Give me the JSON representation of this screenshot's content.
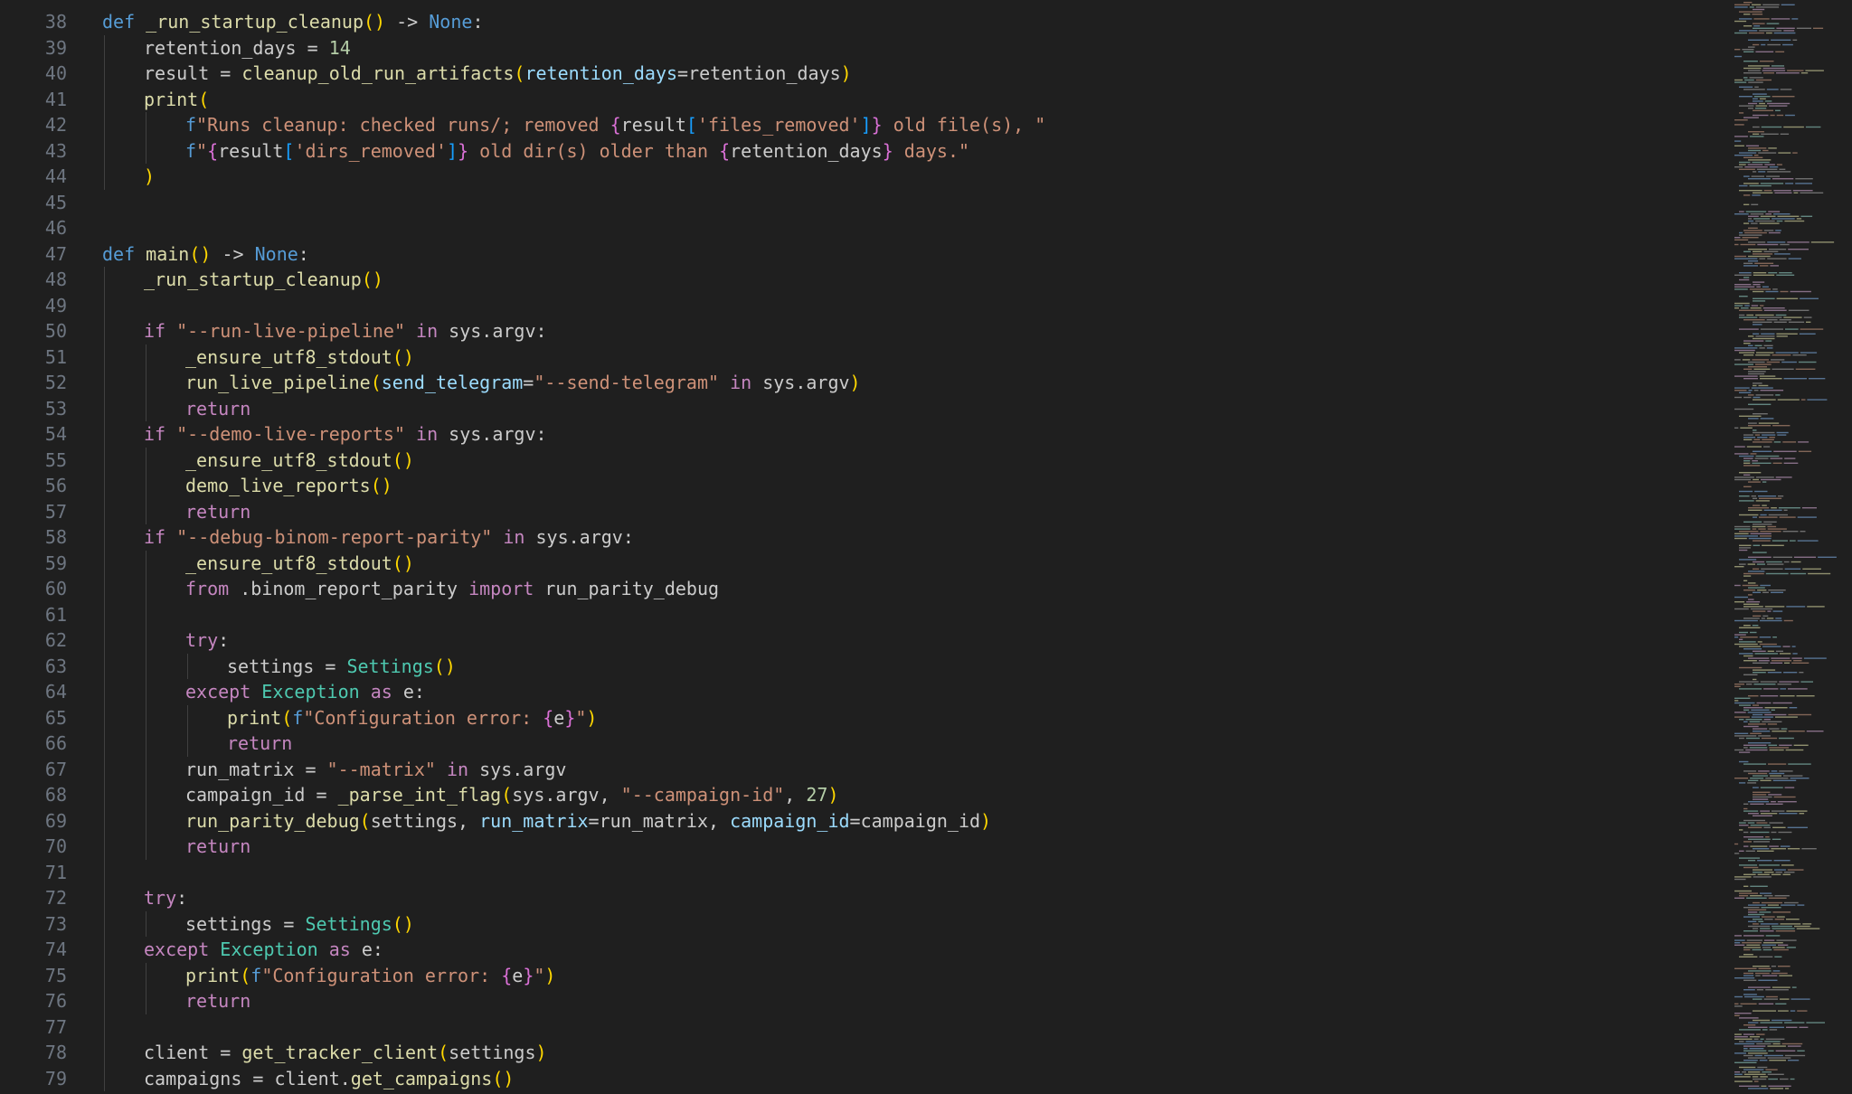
{
  "editor": {
    "colors": {
      "background": "#1f1f1f",
      "line_number": "#6e7681",
      "plain": "#cccccc",
      "keyword": "#569cd6",
      "control": "#c586c0",
      "function": "#dcdcaa",
      "string": "#ce9178",
      "number": "#b5cea8",
      "parameter": "#9cdcfe",
      "class": "#4ec9b0",
      "bracket_1": "#ffd700",
      "bracket_2": "#da70d6",
      "bracket_3": "#179fff"
    },
    "lines": [
      {
        "n": "38",
        "indent": 0,
        "tokens": [
          [
            "kw",
            "def "
          ],
          [
            "fn",
            "_run_startup_cleanup"
          ],
          [
            "br1",
            "()"
          ],
          [
            "plain",
            " -> "
          ],
          [
            "kw",
            "None"
          ],
          [
            "plain",
            ":"
          ]
        ]
      },
      {
        "n": "39",
        "indent": 1,
        "tokens": [
          [
            "plain",
            "retention_days = "
          ],
          [
            "num",
            "14"
          ]
        ]
      },
      {
        "n": "40",
        "indent": 1,
        "tokens": [
          [
            "plain",
            "result = "
          ],
          [
            "fn",
            "cleanup_old_run_artifacts"
          ],
          [
            "br1",
            "("
          ],
          [
            "param",
            "retention_days"
          ],
          [
            "plain",
            "=retention_days"
          ],
          [
            "br1",
            ")"
          ]
        ]
      },
      {
        "n": "41",
        "indent": 1,
        "tokens": [
          [
            "fn",
            "print"
          ],
          [
            "br1",
            "("
          ]
        ]
      },
      {
        "n": "42",
        "indent": 2,
        "tokens": [
          [
            "kw",
            "f"
          ],
          [
            "str",
            "\"Runs cleanup: checked runs/; removed "
          ],
          [
            "br2",
            "{"
          ],
          [
            "plain",
            "result"
          ],
          [
            "br3",
            "["
          ],
          [
            "str",
            "'files_removed'"
          ],
          [
            "br3",
            "]"
          ],
          [
            "br2",
            "}"
          ],
          [
            "str",
            " old file(s), \""
          ]
        ]
      },
      {
        "n": "43",
        "indent": 2,
        "tokens": [
          [
            "kw",
            "f"
          ],
          [
            "str",
            "\""
          ],
          [
            "br2",
            "{"
          ],
          [
            "plain",
            "result"
          ],
          [
            "br3",
            "["
          ],
          [
            "str",
            "'dirs_removed'"
          ],
          [
            "br3",
            "]"
          ],
          [
            "br2",
            "}"
          ],
          [
            "str",
            " old dir(s) older than "
          ],
          [
            "br2",
            "{"
          ],
          [
            "plain",
            "retention_days"
          ],
          [
            "br2",
            "}"
          ],
          [
            "str",
            " days.\""
          ]
        ]
      },
      {
        "n": "44",
        "indent": 1,
        "tokens": [
          [
            "br1",
            ")"
          ]
        ]
      },
      {
        "n": "45",
        "indent": 0,
        "tokens": []
      },
      {
        "n": "46",
        "indent": 0,
        "tokens": []
      },
      {
        "n": "47",
        "indent": 0,
        "tokens": [
          [
            "kw",
            "def "
          ],
          [
            "fn",
            "main"
          ],
          [
            "br1",
            "()"
          ],
          [
            "plain",
            " -> "
          ],
          [
            "kw",
            "None"
          ],
          [
            "plain",
            ":"
          ]
        ]
      },
      {
        "n": "48",
        "indent": 1,
        "tokens": [
          [
            "fn",
            "_run_startup_cleanup"
          ],
          [
            "br1",
            "()"
          ]
        ]
      },
      {
        "n": "49",
        "indent": 1,
        "tokens": []
      },
      {
        "n": "50",
        "indent": 1,
        "tokens": [
          [
            "ctl",
            "if "
          ],
          [
            "str",
            "\"--run-live-pipeline\""
          ],
          [
            "ctl",
            " in"
          ],
          [
            "plain",
            " sys.argv:"
          ]
        ]
      },
      {
        "n": "51",
        "indent": 2,
        "tokens": [
          [
            "fn",
            "_ensure_utf8_stdout"
          ],
          [
            "br1",
            "()"
          ]
        ]
      },
      {
        "n": "52",
        "indent": 2,
        "tokens": [
          [
            "fn",
            "run_live_pipeline"
          ],
          [
            "br1",
            "("
          ],
          [
            "param",
            "send_telegram"
          ],
          [
            "plain",
            "="
          ],
          [
            "str",
            "\"--send-telegram\""
          ],
          [
            "ctl",
            " in"
          ],
          [
            "plain",
            " sys.argv"
          ],
          [
            "br1",
            ")"
          ]
        ]
      },
      {
        "n": "53",
        "indent": 2,
        "tokens": [
          [
            "ctl",
            "return"
          ]
        ]
      },
      {
        "n": "54",
        "indent": 1,
        "tokens": [
          [
            "ctl",
            "if "
          ],
          [
            "str",
            "\"--demo-live-reports\""
          ],
          [
            "ctl",
            " in"
          ],
          [
            "plain",
            " sys.argv:"
          ]
        ]
      },
      {
        "n": "55",
        "indent": 2,
        "tokens": [
          [
            "fn",
            "_ensure_utf8_stdout"
          ],
          [
            "br1",
            "()"
          ]
        ]
      },
      {
        "n": "56",
        "indent": 2,
        "tokens": [
          [
            "fn",
            "demo_live_reports"
          ],
          [
            "br1",
            "()"
          ]
        ]
      },
      {
        "n": "57",
        "indent": 2,
        "tokens": [
          [
            "ctl",
            "return"
          ]
        ]
      },
      {
        "n": "58",
        "indent": 1,
        "tokens": [
          [
            "ctl",
            "if "
          ],
          [
            "str",
            "\"--debug-binom-report-parity\""
          ],
          [
            "ctl",
            " in"
          ],
          [
            "plain",
            " sys.argv:"
          ]
        ]
      },
      {
        "n": "59",
        "indent": 2,
        "tokens": [
          [
            "fn",
            "_ensure_utf8_stdout"
          ],
          [
            "br1",
            "()"
          ]
        ]
      },
      {
        "n": "60",
        "indent": 2,
        "tokens": [
          [
            "ctl",
            "from"
          ],
          [
            "plain",
            " .binom_report_parity "
          ],
          [
            "ctl",
            "import"
          ],
          [
            "plain",
            " run_parity_debug"
          ]
        ]
      },
      {
        "n": "61",
        "indent": 2,
        "tokens": []
      },
      {
        "n": "62",
        "indent": 2,
        "tokens": [
          [
            "ctl",
            "try"
          ],
          [
            "plain",
            ":"
          ]
        ]
      },
      {
        "n": "63",
        "indent": 3,
        "tokens": [
          [
            "plain",
            "settings = "
          ],
          [
            "cls",
            "Settings"
          ],
          [
            "br1",
            "()"
          ]
        ]
      },
      {
        "n": "64",
        "indent": 2,
        "tokens": [
          [
            "ctl",
            "except "
          ],
          [
            "cls",
            "Exception"
          ],
          [
            "ctl",
            " as"
          ],
          [
            "plain",
            " e:"
          ]
        ]
      },
      {
        "n": "65",
        "indent": 3,
        "tokens": [
          [
            "fn",
            "print"
          ],
          [
            "br1",
            "("
          ],
          [
            "kw",
            "f"
          ],
          [
            "str",
            "\"Configuration error: "
          ],
          [
            "br2",
            "{"
          ],
          [
            "plain",
            "e"
          ],
          [
            "br2",
            "}"
          ],
          [
            "str",
            "\""
          ],
          [
            "br1",
            ")"
          ]
        ]
      },
      {
        "n": "66",
        "indent": 3,
        "tokens": [
          [
            "ctl",
            "return"
          ]
        ]
      },
      {
        "n": "67",
        "indent": 2,
        "tokens": [
          [
            "plain",
            "run_matrix = "
          ],
          [
            "str",
            "\"--matrix\""
          ],
          [
            "ctl",
            " in"
          ],
          [
            "plain",
            " sys.argv"
          ]
        ]
      },
      {
        "n": "68",
        "indent": 2,
        "tokens": [
          [
            "plain",
            "campaign_id = "
          ],
          [
            "fn",
            "_parse_int_flag"
          ],
          [
            "br1",
            "("
          ],
          [
            "plain",
            "sys.argv, "
          ],
          [
            "str",
            "\"--campaign-id\""
          ],
          [
            "plain",
            ", "
          ],
          [
            "num",
            "27"
          ],
          [
            "br1",
            ")"
          ]
        ]
      },
      {
        "n": "69",
        "indent": 2,
        "tokens": [
          [
            "fn",
            "run_parity_debug"
          ],
          [
            "br1",
            "("
          ],
          [
            "plain",
            "settings, "
          ],
          [
            "param",
            "run_matrix"
          ],
          [
            "plain",
            "=run_matrix, "
          ],
          [
            "param",
            "campaign_id"
          ],
          [
            "plain",
            "=campaign_id"
          ],
          [
            "br1",
            ")"
          ]
        ]
      },
      {
        "n": "70",
        "indent": 2,
        "tokens": [
          [
            "ctl",
            "return"
          ]
        ]
      },
      {
        "n": "71",
        "indent": 1,
        "tokens": []
      },
      {
        "n": "72",
        "indent": 1,
        "tokens": [
          [
            "ctl",
            "try"
          ],
          [
            "plain",
            ":"
          ]
        ]
      },
      {
        "n": "73",
        "indent": 2,
        "tokens": [
          [
            "plain",
            "settings = "
          ],
          [
            "cls",
            "Settings"
          ],
          [
            "br1",
            "()"
          ]
        ]
      },
      {
        "n": "74",
        "indent": 1,
        "tokens": [
          [
            "ctl",
            "except "
          ],
          [
            "cls",
            "Exception"
          ],
          [
            "ctl",
            " as"
          ],
          [
            "plain",
            " e:"
          ]
        ]
      },
      {
        "n": "75",
        "indent": 2,
        "tokens": [
          [
            "fn",
            "print"
          ],
          [
            "br1",
            "("
          ],
          [
            "kw",
            "f"
          ],
          [
            "str",
            "\"Configuration error: "
          ],
          [
            "br2",
            "{"
          ],
          [
            "plain",
            "e"
          ],
          [
            "br2",
            "}"
          ],
          [
            "str",
            "\""
          ],
          [
            "br1",
            ")"
          ]
        ]
      },
      {
        "n": "76",
        "indent": 2,
        "tokens": [
          [
            "ctl",
            "return"
          ]
        ]
      },
      {
        "n": "77",
        "indent": 1,
        "tokens": []
      },
      {
        "n": "78",
        "indent": 1,
        "tokens": [
          [
            "plain",
            "client = "
          ],
          [
            "fn",
            "get_tracker_client"
          ],
          [
            "br1",
            "("
          ],
          [
            "plain",
            "settings"
          ],
          [
            "br1",
            ")"
          ]
        ]
      },
      {
        "n": "79",
        "indent": 1,
        "tokens": [
          [
            "plain",
            "campaigns = client."
          ],
          [
            "fn",
            "get_campaigns"
          ],
          [
            "br1",
            "()"
          ]
        ]
      }
    ]
  },
  "minimap": {
    "label": "minimap"
  }
}
